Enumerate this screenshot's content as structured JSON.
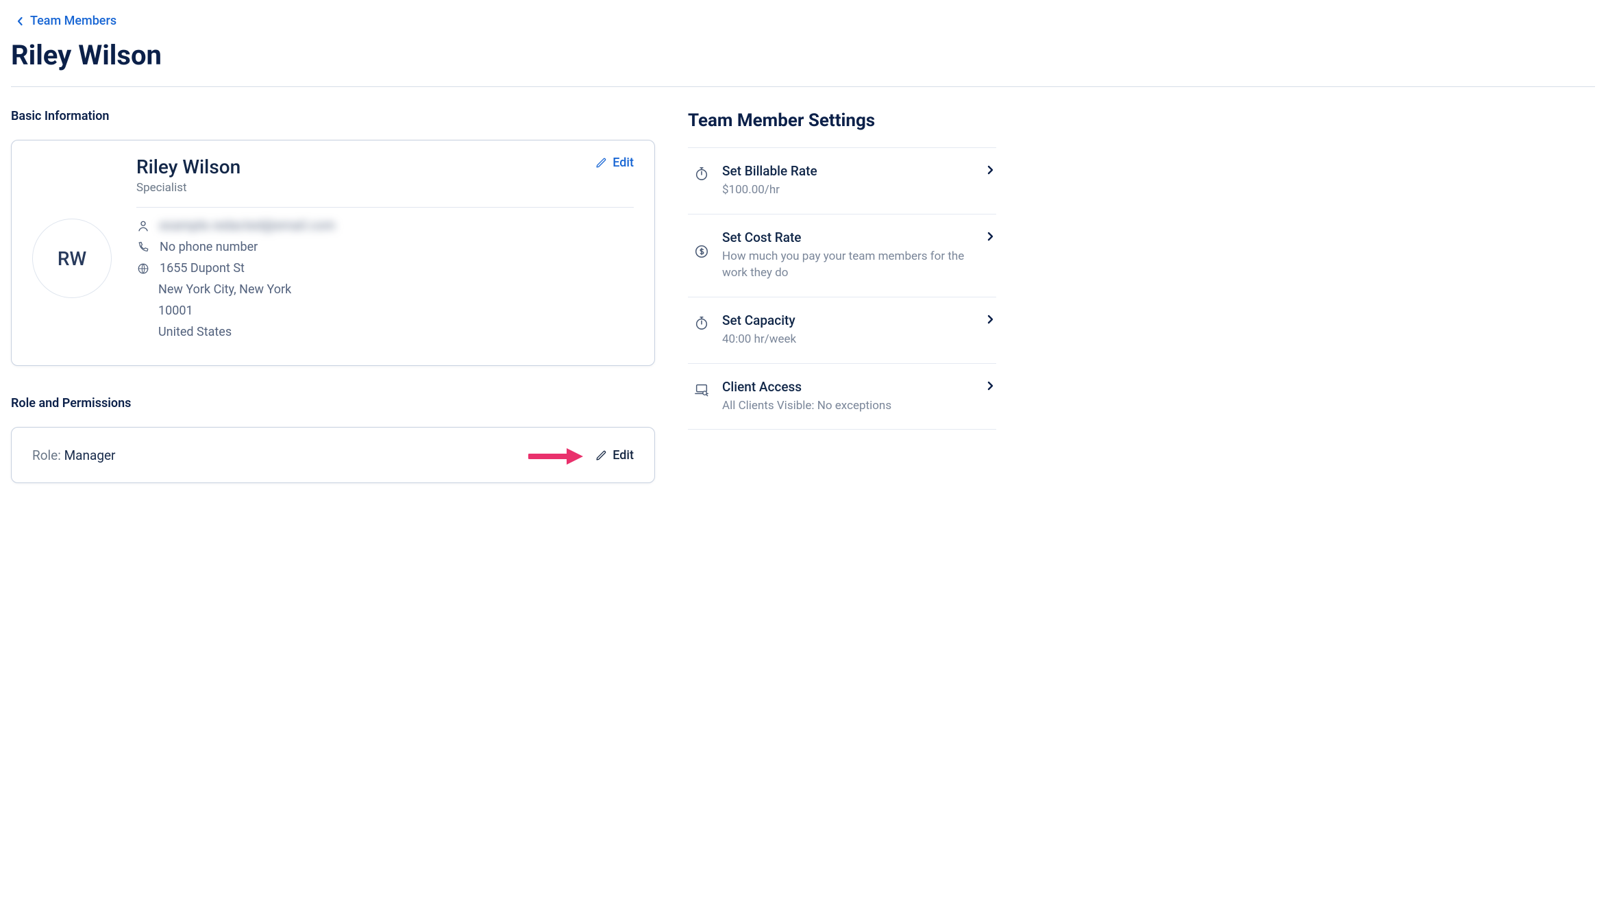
{
  "breadcrumb": {
    "label": "Team Members"
  },
  "page_title": "Riley Wilson",
  "basic": {
    "section_heading": "Basic Information",
    "avatar_initials": "RW",
    "name": "Riley Wilson",
    "subtitle": "Specialist",
    "edit_label": "Edit",
    "email_redacted": "example.redacted@email.com",
    "phone": "No phone number",
    "address_line1": "1655 Dupont St",
    "address_line2": "New York City, New York",
    "postal": "10001",
    "country": "United States"
  },
  "role_section": {
    "heading": "Role and Permissions",
    "label": "Role: ",
    "value": "Manager",
    "edit_label": "Edit"
  },
  "settings": {
    "heading": "Team Member Settings",
    "items": [
      {
        "title": "Set Billable Rate",
        "subtitle": "$100.00/hr",
        "icon": "stopwatch-icon"
      },
      {
        "title": "Set Cost Rate",
        "subtitle": "How much you pay your team members for the work they do",
        "icon": "dollar-circle-icon"
      },
      {
        "title": "Set Capacity",
        "subtitle": "40:00 hr/week",
        "icon": "stopwatch-icon"
      },
      {
        "title": "Client Access",
        "subtitle": "All Clients Visible: No exceptions",
        "icon": "laptop-search-icon"
      }
    ]
  }
}
